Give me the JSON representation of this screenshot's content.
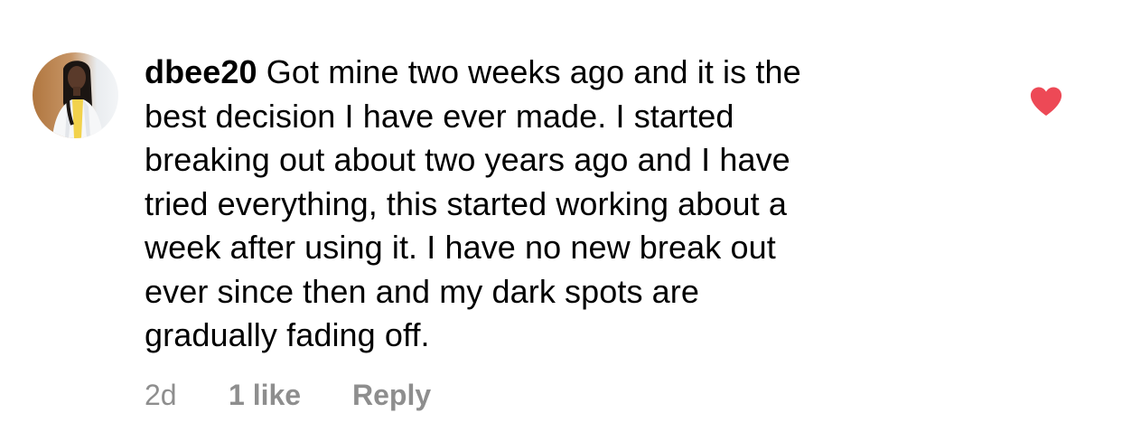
{
  "comment": {
    "username": "dbee20",
    "text_lines": [
      "Got mine two weeks ago and it is the",
      "best decision I have ever made. I started",
      "breaking out about two years ago and I have",
      "tried everything, this started working about a",
      "week after using it. I have no new break out",
      "ever since then and my dark spots are",
      "gradually fading off."
    ],
    "time_ago": "2d",
    "likes": "1 like",
    "reply_label": "Reply",
    "liked": true,
    "heart_icon": "heart-filled-icon",
    "heart_color": "#ed4956",
    "meta_color": "#8e8e8e"
  }
}
